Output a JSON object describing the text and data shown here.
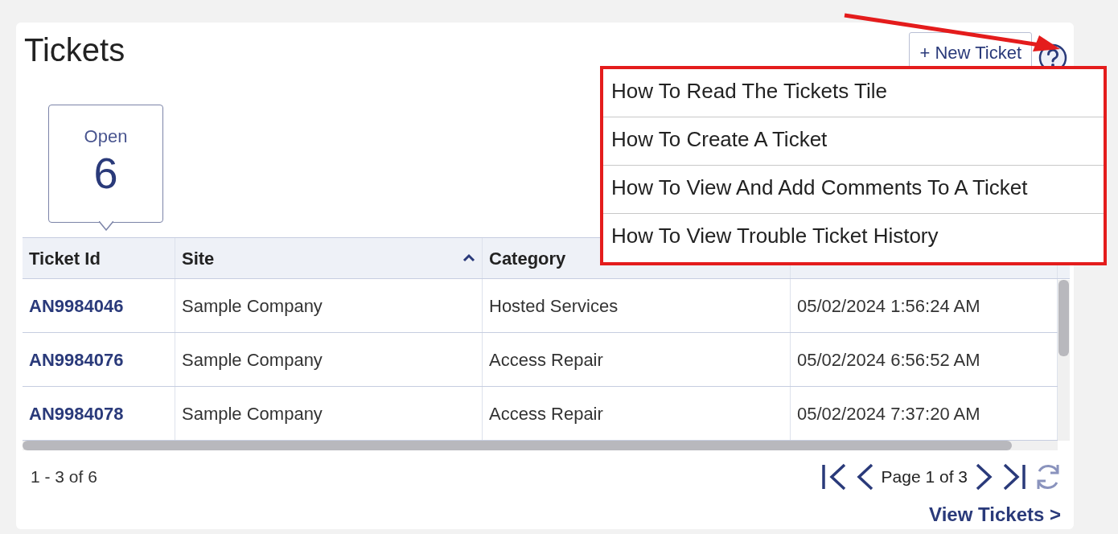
{
  "title": "Tickets",
  "new_ticket_button": "+ New Ticket",
  "status_tile": {
    "label": "Open",
    "count": "6"
  },
  "help_menu": [
    {
      "label": "How To Read The Tickets Tile"
    },
    {
      "label": "How To Create A Ticket"
    },
    {
      "label": "How To View And Add Comments To A Ticket"
    },
    {
      "label": "How To View Trouble Ticket History"
    }
  ],
  "table": {
    "columns": [
      {
        "label": "Ticket Id",
        "sorted": false
      },
      {
        "label": "Site",
        "sorted": true
      },
      {
        "label": "Category",
        "sorted": false
      }
    ],
    "rows": [
      [
        "AN9984046",
        "Sample Company",
        "Hosted Services",
        "05/02/2024 1:56:24 AM"
      ],
      [
        "AN9984076",
        "Sample Company",
        "Access Repair",
        "05/02/2024 6:56:52 AM"
      ],
      [
        "AN9984078",
        "Sample Company",
        "Access Repair",
        "05/02/2024 7:37:20 AM"
      ]
    ]
  },
  "range": "1 - 3 of 6",
  "pager": {
    "label": "Page 1 of 3"
  },
  "view_link": "View Tickets >"
}
